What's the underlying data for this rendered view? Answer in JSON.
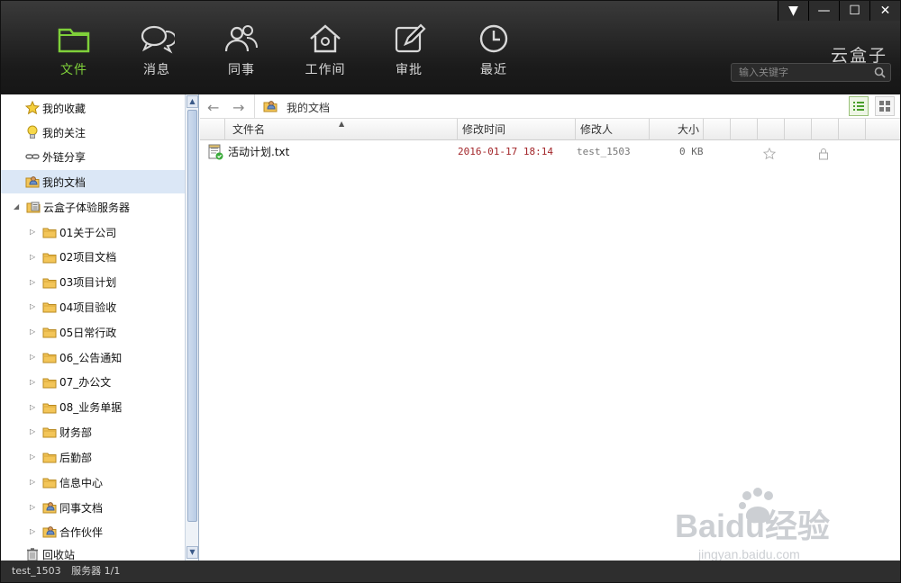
{
  "nav": [
    {
      "id": "files",
      "label": "文件",
      "icon": "folder-icon",
      "active": true
    },
    {
      "id": "messages",
      "label": "消息",
      "icon": "chat-bubbles-icon",
      "active": false
    },
    {
      "id": "colleagues",
      "label": "同事",
      "icon": "people-icon",
      "active": false
    },
    {
      "id": "workspace",
      "label": "工作间",
      "icon": "house-icon",
      "active": false
    },
    {
      "id": "approval",
      "label": "审批",
      "icon": "pencil-icon",
      "active": false
    },
    {
      "id": "recent",
      "label": "最近",
      "icon": "clock-icon",
      "active": false
    }
  ],
  "window": {
    "dropdown": "▼",
    "minimize": "—",
    "maximize": "☐",
    "close": "✕"
  },
  "brand": "云盒子",
  "search": {
    "placeholder": "输入关键字",
    "icon": "magnifier-icon"
  },
  "sidebar": {
    "quick": [
      {
        "label": "我的收藏",
        "icon": "star-icon"
      },
      {
        "label": "我的关注",
        "icon": "lightbulb-icon"
      },
      {
        "label": "外链分享",
        "icon": "chain-link-icon"
      },
      {
        "label": "我的文档",
        "icon": "user-folder-icon",
        "selected": true
      }
    ],
    "server": {
      "label": "云盒子体验服务器",
      "icon": "server-icon"
    },
    "folders": [
      "01关于公司",
      "02项目文档",
      "03项目计划",
      "04项目验收",
      "05日常行政",
      "06_公告通知",
      "07_办公文",
      "08_业务单据",
      "财务部",
      "后勤部",
      "信息中心"
    ],
    "special": [
      {
        "label": "同事文档",
        "icon": "user-folder-icon"
      },
      {
        "label": "合作伙伴",
        "icon": "user-folder-icon"
      }
    ],
    "trash": {
      "label": "回收站",
      "icon": "trash-icon"
    }
  },
  "toolbar": {
    "back": "←",
    "forward": "→",
    "path": "我的文档"
  },
  "columns": {
    "name": "文件名",
    "modified": "修改时间",
    "modifier": "修改人",
    "size": "大小"
  },
  "files": [
    {
      "name": "活动计划.txt",
      "modified": "2016-01-17 18:14",
      "modifier": "test_1503",
      "size": "0 KB"
    }
  ],
  "status": {
    "user": "test_1503",
    "server": "服务器 1/1"
  },
  "watermark": {
    "text": "Baidu经验",
    "url": "jingyan.baidu.com"
  },
  "colors": {
    "accent": "#7fd03a",
    "header": "#1b1b1b",
    "date": "#a3262a"
  }
}
